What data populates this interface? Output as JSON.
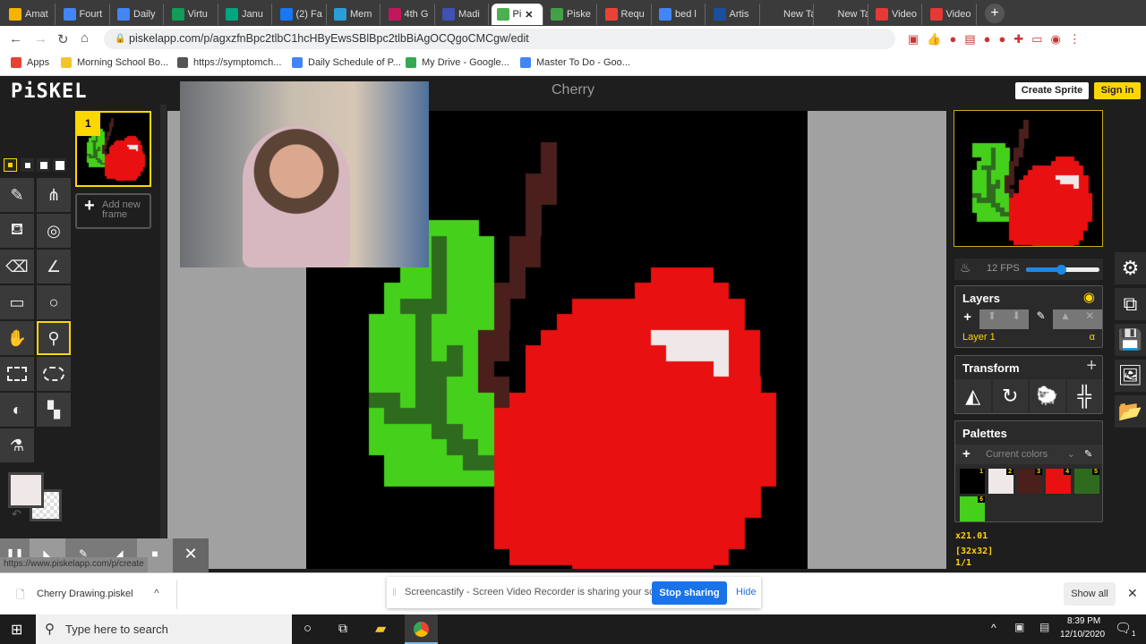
{
  "browser": {
    "tabs": [
      {
        "label": "Amat",
        "color": "#f4b400"
      },
      {
        "label": "Fourt",
        "color": "#4285f4"
      },
      {
        "label": "Daily",
        "color": "#4285f4"
      },
      {
        "label": "Virtu",
        "color": "#0f9d58"
      },
      {
        "label": "Janu",
        "color": "#00a67e"
      },
      {
        "label": "(2) Fa",
        "color": "#1877f2"
      },
      {
        "label": "Mem",
        "color": "#2a9fd6"
      },
      {
        "label": "4th G",
        "color": "#c2185b"
      },
      {
        "label": "Madi",
        "color": "#3f51b5"
      },
      {
        "label": "Pi",
        "color": "#4caf50",
        "active": true
      },
      {
        "label": "Piske",
        "color": "#43a047"
      },
      {
        "label": "Requ",
        "color": "#ea4335"
      },
      {
        "label": "bed l",
        "color": "#4285f4"
      },
      {
        "label": "Artis",
        "color": "#1a4fa0"
      },
      {
        "label": "New Tab",
        "color": ""
      },
      {
        "label": "New Tab",
        "color": ""
      },
      {
        "label": "Video",
        "color": "#e53935"
      },
      {
        "label": "Video",
        "color": "#e53935"
      }
    ],
    "url": "piskelapp.com/p/agxzfnBpc2tlbC1hcHByEwsSBlBpc2tlbBiAgOCQgoCMCgw/edit",
    "bookmarks": [
      "Apps",
      "Morning School Bo...",
      "https://symptomch...",
      "Daily Schedule of P...",
      "My Drive - Google...",
      "Master To Do - Goo..."
    ]
  },
  "app": {
    "logo": "PiSKEL",
    "title": "Cherry",
    "create_sprite": "Create Sprite",
    "sign_in": "Sign in",
    "frame_number": "1",
    "add_frame": "Add new frame",
    "fps": "12 FPS",
    "fps_value": 12,
    "fps_range": [
      1,
      24
    ],
    "layers_title": "Layers",
    "layer_name": "Layer 1",
    "layer_alpha": "α",
    "transform_title": "Transform",
    "palettes_title": "Palettes",
    "palette_select": "Current colors",
    "zoom": "x21.01",
    "dimensions": "[32x32]",
    "frame_index": "1/1",
    "primary_color": "#f0e8e8",
    "accent": "#ffd700"
  },
  "palette": [
    {
      "n": "1",
      "color": "#000000"
    },
    {
      "n": "2",
      "color": "#f0e8e8"
    },
    {
      "n": "3",
      "color": "#4a1f1c"
    },
    {
      "n": "4",
      "color": "#e81010"
    },
    {
      "n": "5",
      "color": "#2e6b1e"
    },
    {
      "n": "6",
      "color": "#45d01c"
    }
  ],
  "sprite": {
    "background": 1,
    "rows": {
      "2": [
        [
          3,
          15,
          15
        ]
      ],
      "3": [
        [
          3,
          15,
          15
        ]
      ],
      "4": [
        [
          3,
          14,
          15
        ]
      ],
      "5": [
        [
          3,
          14,
          15
        ]
      ],
      "6": [
        [
          3,
          14,
          14
        ]
      ],
      "7": [
        [
          6,
          4,
          10
        ],
        [
          3,
          14,
          14
        ]
      ],
      "8": [
        [
          6,
          4,
          7
        ],
        [
          5,
          8,
          8
        ],
        [
          6,
          9,
          11
        ],
        [
          3,
          13,
          14
        ]
      ],
      "9": [
        [
          6,
          4,
          7
        ],
        [
          5,
          8,
          8
        ],
        [
          6,
          9,
          11
        ],
        [
          3,
          13,
          14
        ]
      ],
      "10": [
        [
          6,
          6,
          7
        ],
        [
          5,
          8,
          8
        ],
        [
          6,
          9,
          11
        ],
        [
          3,
          13,
          13
        ],
        [
          4,
          22,
          25
        ]
      ],
      "11": [
        [
          6,
          5,
          7
        ],
        [
          5,
          8,
          8
        ],
        [
          6,
          9,
          11
        ],
        [
          3,
          12,
          13
        ],
        [
          4,
          21,
          26
        ]
      ],
      "12": [
        [
          6,
          5,
          5
        ],
        [
          5,
          6,
          8
        ],
        [
          6,
          9,
          11
        ],
        [
          3,
          12,
          12
        ],
        [
          4,
          17,
          27
        ]
      ],
      "13": [
        [
          6,
          4,
          6
        ],
        [
          5,
          7,
          7
        ],
        [
          6,
          8,
          11
        ],
        [
          3,
          12,
          12
        ],
        [
          4,
          16,
          27
        ]
      ],
      "14": [
        [
          6,
          4,
          6
        ],
        [
          5,
          7,
          7
        ],
        [
          6,
          8,
          10
        ],
        [
          3,
          11,
          12
        ],
        [
          4,
          15,
          21
        ],
        [
          2,
          22,
          26
        ],
        [
          4,
          27,
          28
        ]
      ],
      "15": [
        [
          6,
          4,
          6
        ],
        [
          5,
          7,
          7
        ],
        [
          6,
          8,
          8
        ],
        [
          5,
          9,
          9
        ],
        [
          6,
          10,
          10
        ],
        [
          3,
          11,
          12
        ],
        [
          4,
          14,
          22
        ],
        [
          2,
          23,
          26
        ],
        [
          4,
          27,
          28
        ]
      ],
      "16": [
        [
          6,
          4,
          6
        ],
        [
          5,
          7,
          9
        ],
        [
          6,
          10,
          10
        ],
        [
          3,
          11,
          11
        ],
        [
          4,
          14,
          25
        ],
        [
          2,
          26,
          26
        ],
        [
          4,
          27,
          28
        ]
      ],
      "17": [
        [
          6,
          4,
          6
        ],
        [
          5,
          7,
          8
        ],
        [
          6,
          9,
          10
        ],
        [
          3,
          11,
          12
        ],
        [
          4,
          14,
          28
        ]
      ],
      "18": [
        [
          5,
          4,
          5
        ],
        [
          6,
          6,
          6
        ],
        [
          5,
          7,
          8
        ],
        [
          6,
          9,
          11
        ],
        [
          3,
          12,
          12
        ],
        [
          4,
          13,
          29
        ]
      ],
      "19": [
        [
          6,
          4,
          4
        ],
        [
          5,
          5,
          8
        ],
        [
          6,
          9,
          11
        ],
        [
          4,
          12,
          29
        ]
      ],
      "20": [
        [
          6,
          4,
          7
        ],
        [
          5,
          8,
          9
        ],
        [
          6,
          10,
          11
        ],
        [
          4,
          12,
          29
        ]
      ],
      "21": [
        [
          6,
          4,
          8
        ],
        [
          5,
          9,
          10
        ],
        [
          6,
          11,
          11
        ],
        [
          4,
          12,
          29
        ]
      ],
      "22": [
        [
          6,
          5,
          9
        ],
        [
          5,
          10,
          11
        ],
        [
          4,
          12,
          29
        ]
      ],
      "23": [
        [
          6,
          5,
          11
        ],
        [
          4,
          12,
          29
        ]
      ],
      "24": [
        [
          4,
          12,
          28
        ]
      ],
      "25": [
        [
          4,
          12,
          28
        ]
      ],
      "26": [
        [
          4,
          12,
          27
        ]
      ],
      "27": [
        [
          4,
          12,
          27
        ]
      ],
      "28": [
        [
          4,
          13,
          26
        ]
      ],
      "29": [
        [
          4,
          17,
          25
        ]
      ]
    }
  },
  "recorder": {
    "status_url": "https://www.piskelapp.com/p/create"
  },
  "shelf": {
    "download": "Cherry Drawing.piskel",
    "notice": "Screencastify - Screen Video Recorder is sharing your screen.",
    "stop": "Stop sharing",
    "hide": "Hide",
    "show_all": "Show all"
  },
  "taskbar": {
    "search_placeholder": "Type here to search",
    "time": "8:39 PM",
    "date": "12/10/2020",
    "notifications": "1"
  }
}
